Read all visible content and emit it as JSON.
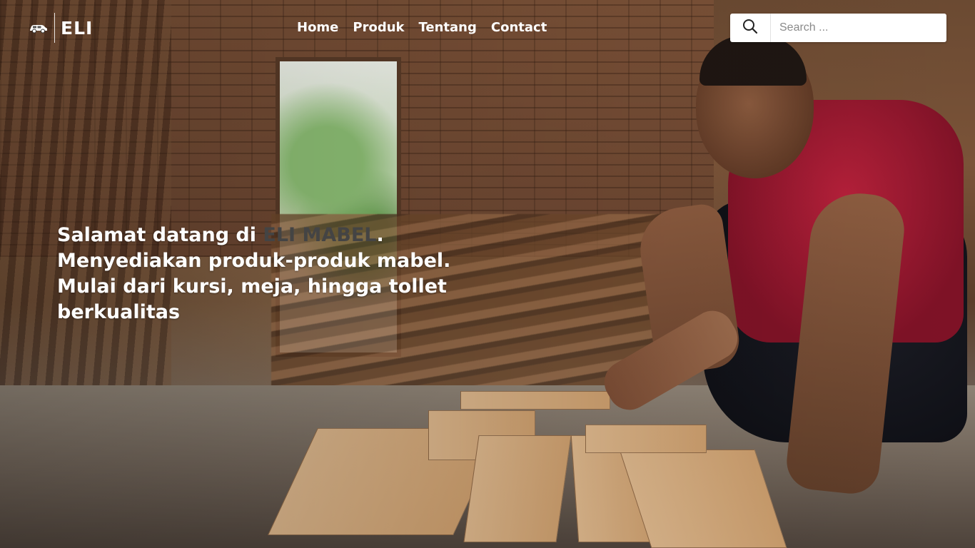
{
  "logo": {
    "text": "ELI",
    "icon": "car-icon"
  },
  "nav": {
    "items": [
      {
        "label": "Home"
      },
      {
        "label": "Produk"
      },
      {
        "label": "Tentang"
      },
      {
        "label": "Contact"
      }
    ]
  },
  "search": {
    "placeholder": "Search ...",
    "value": "",
    "icon": "search-icon"
  },
  "hero": {
    "greeting": "Salamat datang di ",
    "brand": "ELI MABEL",
    "punct": ".",
    "line2": "Menyediakan produk-produk mabel.",
    "line3": "Mulai dari kursi, meja, hingga tollet",
    "line4": "berkualitas"
  },
  "colors": {
    "brand_text": "#444444",
    "text": "#ffffff"
  }
}
